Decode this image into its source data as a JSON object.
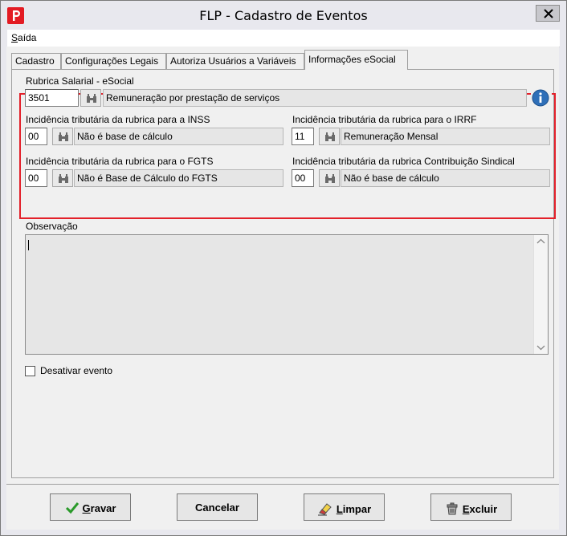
{
  "window": {
    "title": "FLP - Cadastro de Eventos"
  },
  "menu": {
    "saida_first": "S",
    "saida_rest": "aída"
  },
  "tabs": [
    {
      "label": "Cadastro"
    },
    {
      "label": "Configurações Legais"
    },
    {
      "label": "Autoriza Usuários a Variáveis"
    },
    {
      "label": "Informações eSocial"
    }
  ],
  "esocial": {
    "rubrica": {
      "label": "Rubrica Salarial - eSocial",
      "code": "3501",
      "description": "Remuneração por prestação de serviços"
    },
    "inss": {
      "label": "Incidência tributária da rubrica para a INSS",
      "code": "00",
      "description": "Não é base de cálculo"
    },
    "irrf": {
      "label": "Incidência tributária da rubrica para o IRRF",
      "code": "11",
      "description": "Remuneração Mensal"
    },
    "fgts": {
      "label": "Incidência tributária da rubrica para o FGTS",
      "code": "00",
      "description": "Não é Base de Cálculo do FGTS"
    },
    "sindical": {
      "label": "Incidência tributária da rubrica Contribuição Sindical",
      "code": "00",
      "description": "Não é base de cálculo"
    }
  },
  "observacao": {
    "label": "Observação",
    "value": ""
  },
  "desativar": {
    "label": "Desativar evento",
    "checked": false
  },
  "buttons": {
    "gravar": {
      "first": "G",
      "rest": "ravar"
    },
    "cancelar": {
      "label": "Cancelar"
    },
    "limpar": {
      "first": "L",
      "rest": "impar"
    },
    "excluir": {
      "first": "E",
      "rest": "xcluir"
    }
  },
  "colors": {
    "highlight_frame": "#e3202a",
    "app_icon": "#e31b23"
  },
  "icons": [
    "app-logo-icon",
    "close-icon",
    "binoculars-icon",
    "info-icon",
    "checkmark-icon",
    "eraser-icon",
    "delete-icon"
  ]
}
